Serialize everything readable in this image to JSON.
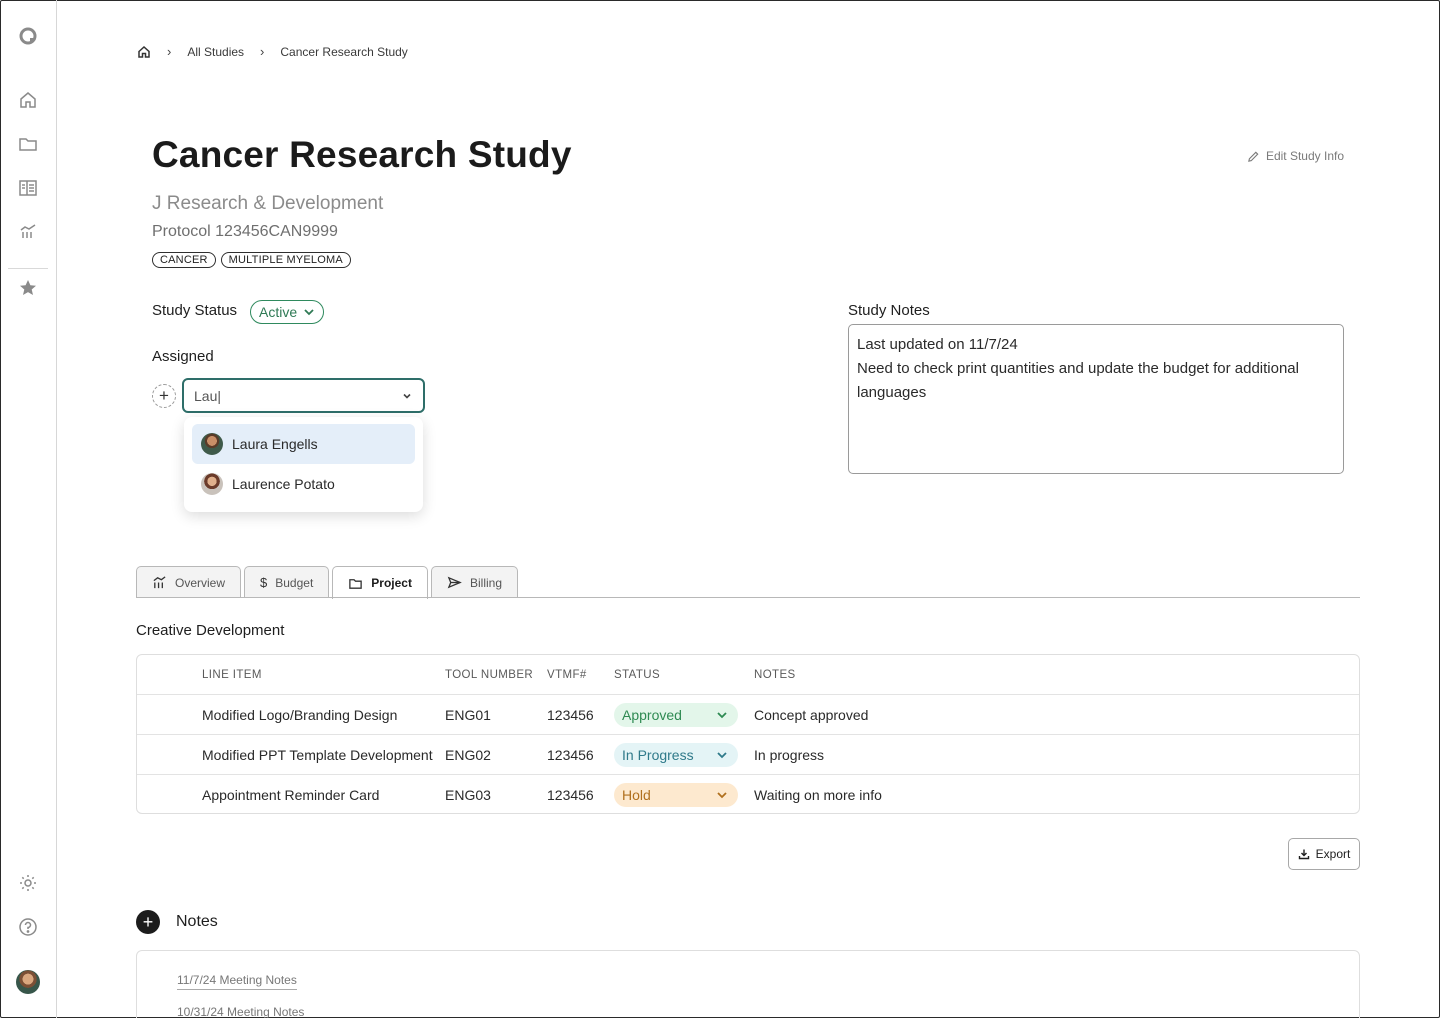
{
  "breadcrumb": {
    "items": [
      "All Studies",
      "Cancer Research Study"
    ]
  },
  "study": {
    "title": "Cancer Research Study",
    "edit_label": "Edit Study Info",
    "subtitle": "J Research & Development",
    "protocol": "Protocol 123456CAN9999",
    "tags": [
      "CANCER",
      "MULTIPLE MYELOMA"
    ],
    "status_label": "Study Status",
    "status_value": "Active",
    "assigned_label": "Assigned",
    "assign_input_value": "Lau|",
    "assign_options": [
      "Laura Engells",
      "Laurence Potato"
    ],
    "notes_label": "Study Notes",
    "notes_lines": [
      "Last updated on 11/7/24",
      "Need to check print quantities and update the budget for additional languages"
    ]
  },
  "tabs": [
    {
      "label": "Overview",
      "icon": "chart-icon",
      "active": false
    },
    {
      "label": "Budget",
      "icon": "dollar-icon",
      "active": false
    },
    {
      "label": "Project",
      "icon": "folder-icon",
      "active": true
    },
    {
      "label": "Billing",
      "icon": "send-icon",
      "active": false
    }
  ],
  "project": {
    "section_title": "Creative Development",
    "columns": [
      "LINE ITEM",
      "TOOL NUMBER",
      "VTMF#",
      "STATUS",
      "NOTES"
    ],
    "rows": [
      {
        "line_item": "Modified Logo/Branding Design",
        "tool_number": "ENG01",
        "vtmf": "123456",
        "status": "Approved",
        "notes": "Concept approved"
      },
      {
        "line_item": "Modified PPT Template Development",
        "tool_number": "ENG02",
        "vtmf": "123456",
        "status": "In Progress",
        "notes": "In progress"
      },
      {
        "line_item": "Appointment Reminder Card",
        "tool_number": "ENG03",
        "vtmf": "123456",
        "status": "Hold",
        "notes": "Waiting on more info"
      }
    ],
    "export_label": "Export"
  },
  "notes": {
    "title": "Notes",
    "items": [
      "11/7/24 Meeting Notes",
      "10/31/24 Meeting Notes"
    ]
  },
  "colors": {
    "accent": "#2e6e69",
    "approved": "#2e8a52",
    "in_progress": "#2f7a8a",
    "hold": "#b0701e"
  }
}
